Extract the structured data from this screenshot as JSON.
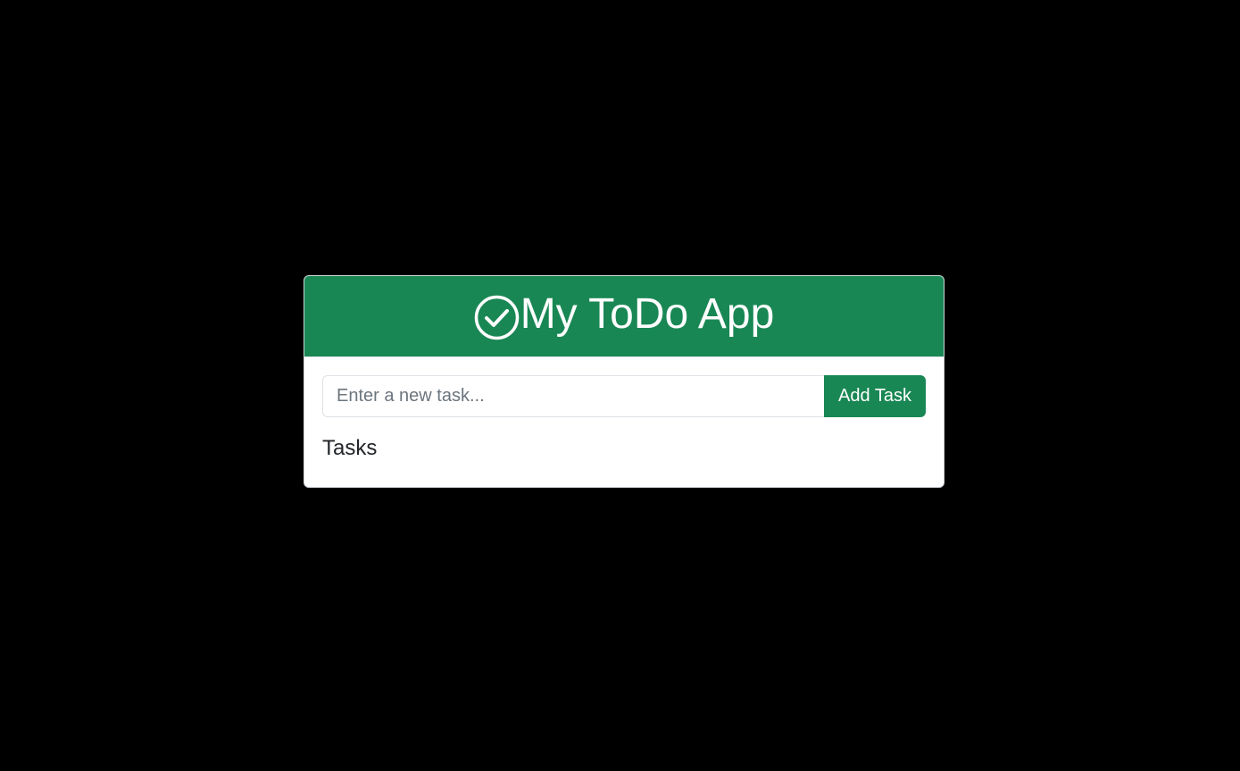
{
  "app": {
    "title": "My ToDo App",
    "header_icon": "check-circle-icon"
  },
  "form": {
    "input_placeholder": "Enter a new task...",
    "input_value": "",
    "add_button_label": "Add Task"
  },
  "tasks_section": {
    "heading": "Tasks",
    "items": []
  },
  "colors": {
    "page_background": "#000000",
    "accent": "#198754",
    "card_background": "#ffffff",
    "text": "#212529"
  }
}
